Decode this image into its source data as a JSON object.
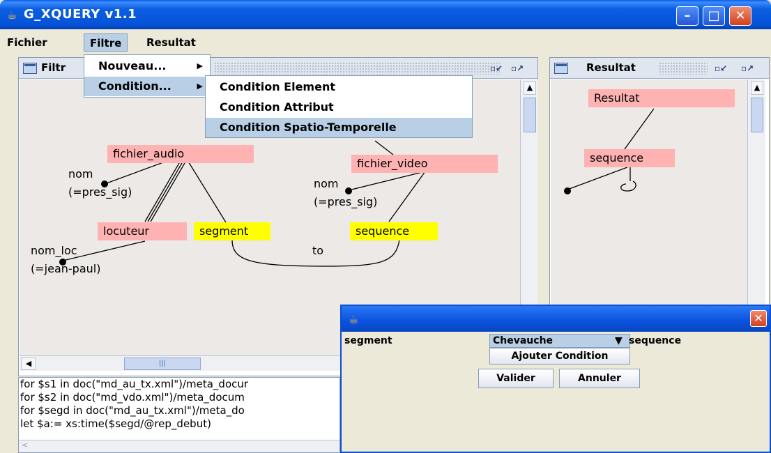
{
  "window": {
    "title": "G_XQUERY v1.1",
    "minimize": "–",
    "maximize": "□",
    "close": "✕"
  },
  "menubar": {
    "items": [
      "Fichier",
      "Filtre",
      "Resultat"
    ]
  },
  "filtre_menu": {
    "items": [
      "Nouveau...",
      "Condition..."
    ]
  },
  "condition_menu": {
    "items": [
      "Condition Element",
      "Condition Attribut",
      "Condition Spatio-Temporelle"
    ]
  },
  "filter_frame": {
    "title": "Filtr"
  },
  "result_frame": {
    "title": "Resultat"
  },
  "graph": {
    "fichier_audio": "fichier_audio",
    "fichier_video": "fichier_video",
    "nom1": "nom",
    "pres1": "(=pres_sig)",
    "nom2": "nom",
    "pres2": "(=pres_sig)",
    "locuteur": "locuteur",
    "segment": "segment",
    "sequence": "sequence",
    "nom_loc": "nom_loc",
    "jean_paul": "(=jean-paul)",
    "to": "to"
  },
  "result_graph": {
    "resultat": "Resultat",
    "sequence": "sequence"
  },
  "query_lines": [
    "for $s1 in doc(\"md_au_tx.xml\")/meta_docur",
    "for $s2 in doc(\"md_vdo.xml\")/meta_docum",
    "for $segd in doc(\"md_au_tx.xml\")/meta_do",
    "let $a:= xs:time($segd/@rep_debut)"
  ],
  "dialog": {
    "left_label": "segment",
    "relation": "Chevauche",
    "right_label": "sequence",
    "add_button": "Ajouter Condition",
    "ok_button": "Valider",
    "cancel_button": "Annuler"
  }
}
